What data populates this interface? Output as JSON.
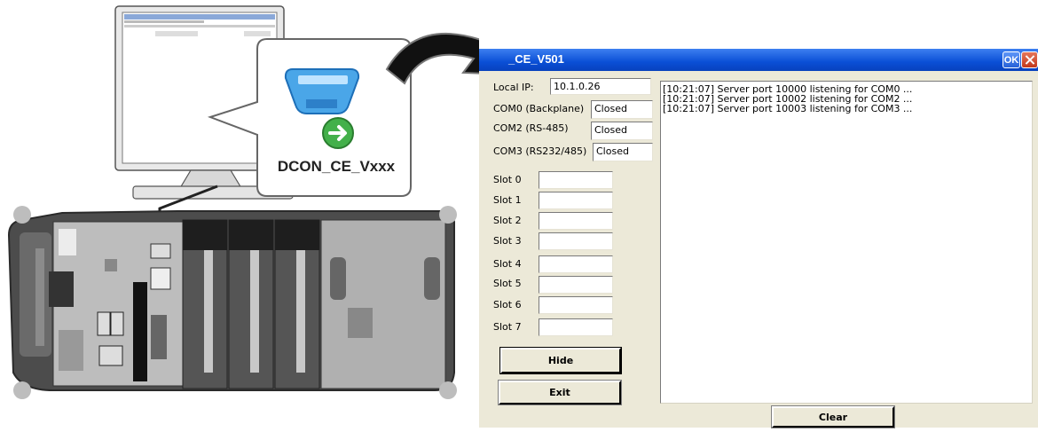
{
  "illustration": {
    "app_label": "DCON_CE_Vxxx"
  },
  "window": {
    "title": "_CE_V501",
    "ok_label": "OK",
    "local_ip_label": "Local IP:",
    "local_ip_value": "10.1.0.26",
    "ports": [
      {
        "label": "COM0 (Backplane)",
        "status": "Closed"
      },
      {
        "label": "COM2 (RS-485)",
        "status": "Closed"
      },
      {
        "label": "COM3 (RS232/485)",
        "status": "Closed"
      }
    ],
    "slots": [
      {
        "label": "Slot 0",
        "value": ""
      },
      {
        "label": "Slot 1",
        "value": ""
      },
      {
        "label": "Slot 2",
        "value": ""
      },
      {
        "label": "Slot 3",
        "value": ""
      },
      {
        "label": "Slot 4",
        "value": ""
      },
      {
        "label": "Slot 5",
        "value": ""
      },
      {
        "label": "Slot 6",
        "value": ""
      },
      {
        "label": "Slot 7",
        "value": ""
      }
    ],
    "hide_label": "Hide",
    "exit_label": "Exit",
    "clear_label": "Clear",
    "log": [
      "[10:21:07] Server port 10000 listening for COM0 ...",
      "[10:21:07] Server port 10002 listening for COM2 ...",
      "[10:21:07] Server port 10003 listening for COM3 ..."
    ]
  },
  "colors": {
    "titlebar": "#0a4fd6",
    "window_bg": "#ece9d8",
    "close_button": "#c2381b"
  }
}
